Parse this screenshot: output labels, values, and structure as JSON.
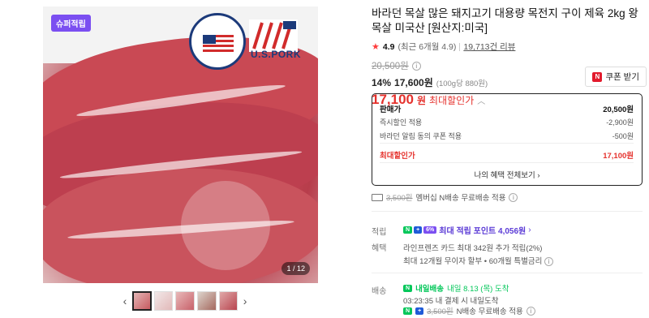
{
  "media": {
    "badge": "슈퍼적립",
    "logo_usmeat": "U.S.MEAT EXPORT FEDERATION",
    "logo_uspork": "U.S.PORK",
    "counter": "1 / 12",
    "thumbnail_count": 5
  },
  "product": {
    "title": "바라던 목살 많은 돼지고기 대용량 목전지 구이 제육 2kg 왕목살 미국산 [원산지:미국]",
    "rating_score": "4.9",
    "rating_detail": "(최근 6개월 4.9)",
    "review_count": "19,713건 리뷰",
    "original_price": "20,500원",
    "discount_pct": "14%",
    "sale_price": "17,600원",
    "unit_price": "(100g당 880원)",
    "max_price_num": "17,100",
    "max_price_won": "원",
    "max_price_label": "최대할인가",
    "coupon_label": "쿠폰 받기"
  },
  "price_box": {
    "head_label": "판매가",
    "head_value": "20,500원",
    "rows": [
      {
        "label": "즉시할인 적용",
        "value": "-2,900원"
      },
      {
        "label": "바라던 알림 동의 쿠폰 적용",
        "value": "-500원"
      }
    ],
    "max_label": "최대할인가",
    "max_value": "17,100원",
    "more_label": "나의 혜택 전체보기"
  },
  "shipping_top": {
    "strike": "3,500원",
    "text": "멤버십 N배송 무료배송 적용"
  },
  "points": {
    "section_label": "적립",
    "n_badge": "N",
    "plus_badge": "+",
    "extra_badge": "6%",
    "text": "최대 적립 포인트 4,056원"
  },
  "benefits": {
    "section_label": "혜택",
    "line1": "라인프렌즈 카드 최대 342원 추가 적립(2%)",
    "line2": "최대 12개월 무이자 할부 • 60개월 특별금리"
  },
  "delivery": {
    "section_label": "배송",
    "badge": "내일배송",
    "arrive": "내일 8.13 (목) 도착",
    "cutoff": "03:23:35  내 결제 시 내일도착",
    "fee_strike": "3,500원",
    "fee_text": "N배송 무료배송 적용"
  },
  "colors": {
    "accent_red": "#e5322d",
    "purple": "#5b3bd6",
    "naver_green": "#03c75a"
  }
}
